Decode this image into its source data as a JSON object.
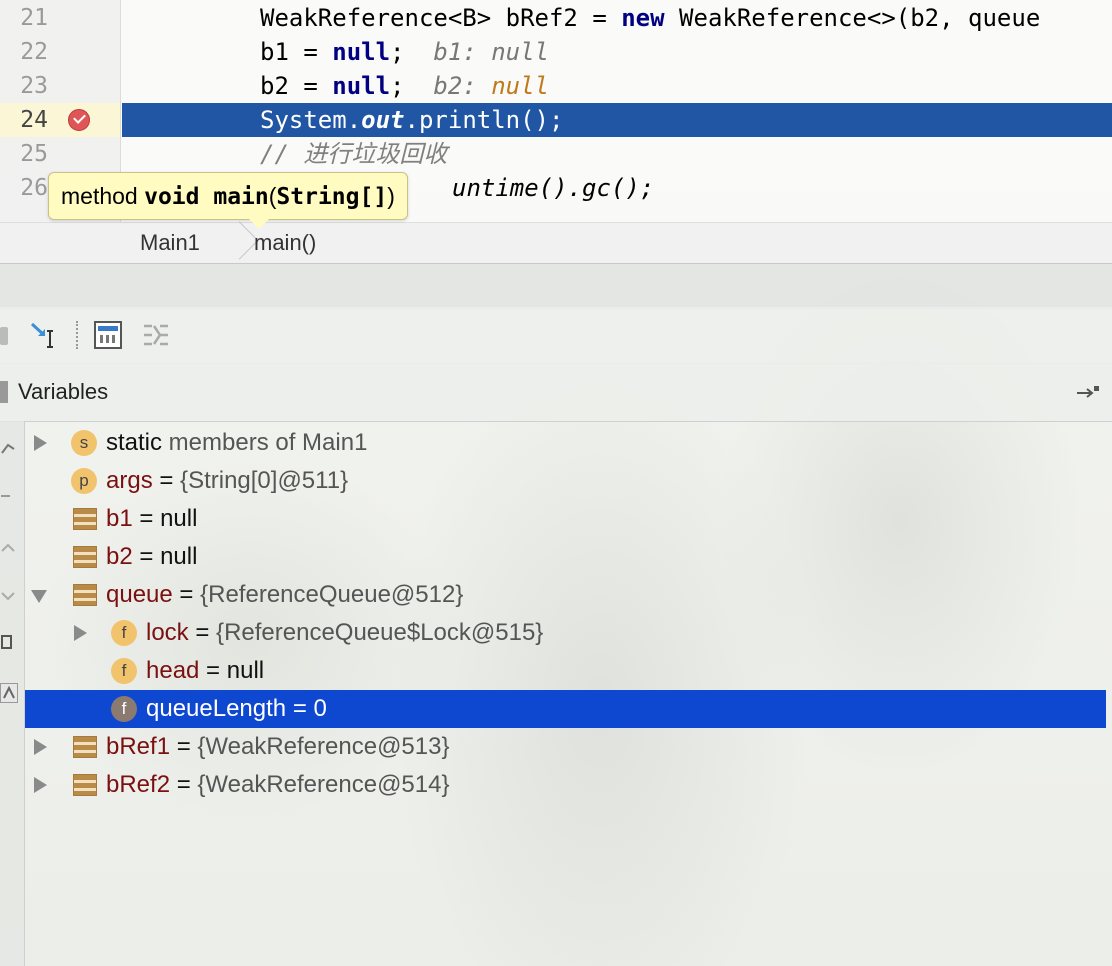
{
  "editor": {
    "lines": [
      {
        "num": "21",
        "a": "WeakReference<B> bRef2 = ",
        "kw": "new",
        "b": " WeakReference<>(b2, queue"
      },
      {
        "num": "22",
        "a": "b1 = ",
        "kw": "null",
        "b": ";  ",
        "hint_name": "b1: ",
        "hint_val": "null"
      },
      {
        "num": "23",
        "a": "b2 = ",
        "kw": "null",
        "b": ";  ",
        "hint_name": "b2: ",
        "hint_val": "null"
      },
      {
        "num": "24",
        "a": "System.",
        "it": "out",
        "b": ".println();"
      },
      {
        "num": "25",
        "comment": "// 进行垃圾回收"
      },
      {
        "num": "26",
        "code": "untime().gc();"
      }
    ],
    "tooltip": {
      "prefix": "method ",
      "sig_a": "void main",
      "paren_open": "(",
      "sig_b": "String[]",
      "paren_close": ")"
    },
    "breadcrumb": [
      "Main1",
      "main()"
    ]
  },
  "variables": {
    "title": "Variables",
    "rows": [
      {
        "badge": "s",
        "name": "static",
        "rest": " members of Main1"
      },
      {
        "badge": "p",
        "name": "args",
        "eq": " = ",
        "val": "{String[0]@511}"
      },
      {
        "name": "b1",
        "eq": " = ",
        "val": "null"
      },
      {
        "name": "b2",
        "eq": " = ",
        "val": "null"
      },
      {
        "name": "queue",
        "eq": " = ",
        "val": "{ReferenceQueue@512}"
      },
      {
        "badge": "f",
        "name": "lock",
        "eq": " = ",
        "val": "{ReferenceQueue$Lock@515}"
      },
      {
        "badge": "f",
        "name": "head",
        "eq": " = ",
        "val": "null"
      },
      {
        "badge": "f",
        "name": "queueLength",
        "eq": " = ",
        "val": "0"
      },
      {
        "name": "bRef1",
        "eq": " = ",
        "val": "{WeakReference@513}"
      },
      {
        "name": "bRef2",
        "eq": " = ",
        "val": "{WeakReference@514}"
      }
    ]
  },
  "colors": {
    "execution_line": "#2156a5",
    "selection": "#0e47d0",
    "tooltip_bg": "#fffbc1"
  }
}
